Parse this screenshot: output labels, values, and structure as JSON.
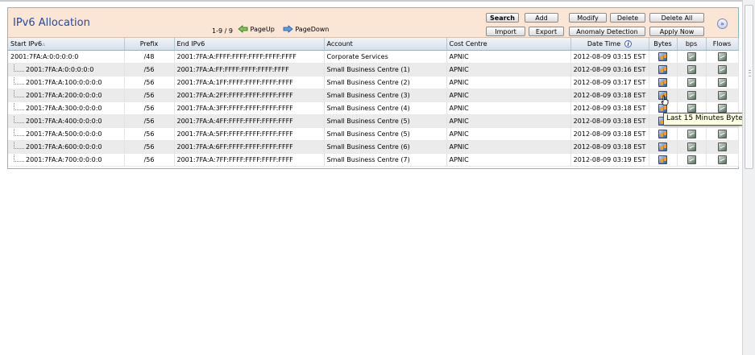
{
  "title": "IPv6 Allocation",
  "pager": {
    "range": "1-9 / 9",
    "page_up": "PageUp",
    "page_down": "PageDown"
  },
  "buttons": {
    "search": "Search",
    "add": "Add",
    "modify": "Modify",
    "delete": "Delete",
    "delete_all": "Delete All",
    "import": "Import",
    "export": "Export",
    "anomaly": "Anomaly Detection",
    "apply_now": "Apply Now"
  },
  "columns": {
    "start": "Start IPv6",
    "prefix": "Prefix",
    "end": "End IPv6",
    "account": "Account",
    "cost": "Cost Centre",
    "date": "Date Time",
    "bytes": "Bytes",
    "bps": "bps",
    "flows": "Flows"
  },
  "rows": [
    {
      "start": "2001:7FA:A:0:0:0:0:0",
      "prefix": "/48",
      "end": "2001:7FA:A:FFFF:FFFF:FFFF:FFFF:FFFF",
      "account": "Corporate Services",
      "cost": "APNIC",
      "date": "2012-08-09 03:15 EST",
      "child": false
    },
    {
      "start": "2001:7FA:A:0:0:0:0:0",
      "prefix": "/56",
      "end": "2001:7FA:A:FF:FFFF:FFFF:FFFF:FFFF",
      "account": "Small Business Centre (1)",
      "cost": "APNIC",
      "date": "2012-08-09 03:16 EST",
      "child": true
    },
    {
      "start": "2001:7FA:A:100:0:0:0:0",
      "prefix": "/56",
      "end": "2001:7FA:A:1FF:FFFF:FFFF:FFFF:FFFF",
      "account": "Small Business Centre (2)",
      "cost": "APNIC",
      "date": "2012-08-09 03:17 EST",
      "child": true
    },
    {
      "start": "2001:7FA:A:200:0:0:0:0",
      "prefix": "/56",
      "end": "2001:7FA:A:2FF:FFFF:FFFF:FFFF:FFFF",
      "account": "Small Business Centre (3)",
      "cost": "APNIC",
      "date": "2012-08-09 03:18 EST",
      "child": true
    },
    {
      "start": "2001:7FA:A:300:0:0:0:0",
      "prefix": "/56",
      "end": "2001:7FA:A:3FF:FFFF:FFFF:FFFF:FFFF",
      "account": "Small Business Centre (4)",
      "cost": "APNIC",
      "date": "2012-08-09 03:18 EST",
      "child": true
    },
    {
      "start": "2001:7FA:A:400:0:0:0:0",
      "prefix": "/56",
      "end": "2001:7FA:A:4FF:FFFF:FFFF:FFFF:FFFF",
      "account": "Small Business Centre (5)",
      "cost": "APNIC",
      "date": "2012-08-09 03:18 EST",
      "child": true
    },
    {
      "start": "2001:7FA:A:500:0:0:0:0",
      "prefix": "/56",
      "end": "2001:7FA:A:5FF:FFFF:FFFF:FFFF:FFFF",
      "account": "Small Business Centre (5)",
      "cost": "APNIC",
      "date": "2012-08-09 03:18 EST",
      "child": true
    },
    {
      "start": "2001:7FA:A:600:0:0:0:0",
      "prefix": "/56",
      "end": "2001:7FA:A:6FF:FFFF:FFFF:FFFF:FFFF",
      "account": "Small Business Centre (6)",
      "cost": "APNIC",
      "date": "2012-08-09 03:18 EST",
      "child": true
    },
    {
      "start": "2001:7FA:A:700:0:0:0:0",
      "prefix": "/56",
      "end": "2001:7FA:A:7FF:FFFF:FFFF:FFFF:FFFF",
      "account": "Small Business Centre (7)",
      "cost": "APNIC",
      "date": "2012-08-09 03:19 EST",
      "child": true
    }
  ],
  "tooltip": "Last 15 Minutes Bytes",
  "icons": {
    "bytes": "bytes-graph-icon",
    "bps": "bps-graph-icon",
    "flows": "flows-graph-icon"
  }
}
